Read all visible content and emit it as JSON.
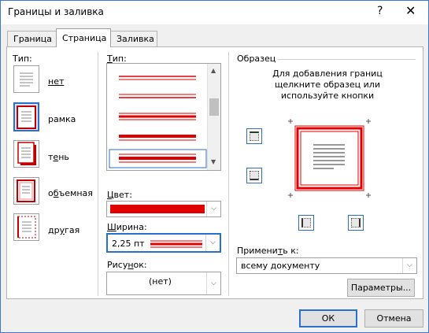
{
  "window": {
    "title": "Границы и заливка",
    "help": "?",
    "close": "✕"
  },
  "tabs": [
    {
      "label": "Граница"
    },
    {
      "label": "Страница"
    },
    {
      "label": "Заливка"
    }
  ],
  "setting": {
    "label": "Тип:",
    "items": [
      {
        "label": "нет"
      },
      {
        "label": "рамка"
      },
      {
        "label": "тень"
      },
      {
        "label": "объемная"
      },
      {
        "label": "другая"
      }
    ]
  },
  "style": {
    "label": "Тип:",
    "color_label": "Цвет:",
    "color_value": "#e00000",
    "width_label": "Ширина:",
    "width_value": "2,25 пт",
    "art_label": "Рисунок:",
    "art_value": "(нет)"
  },
  "preview": {
    "label": "Образец",
    "hint_line1": "Для добавления границ",
    "hint_line2": "щелкните образец или",
    "hint_line3": "используйте кнопки",
    "apply_label": "Применить к:",
    "apply_value": "всему документу",
    "options_button": "Параметры..."
  },
  "footer": {
    "ok": "ОК",
    "cancel": "Отмена"
  }
}
